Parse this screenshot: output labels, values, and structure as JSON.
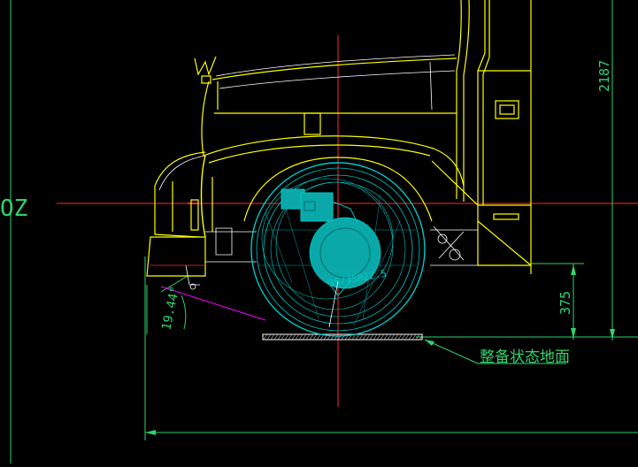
{
  "drawing": {
    "dimension_height": "2187",
    "dimension_ground_clearance": "375",
    "angle_label": "19.44°",
    "partial_dimension_text": "OZ",
    "tire_spec": "35/45R22.5",
    "ground_annotation": "整备状态地面"
  },
  "colors": {
    "background": "#000000",
    "body_lines": "#ffff00",
    "white_lines": "#ffffff",
    "wheel": "#00c8c8",
    "wheel_fill": "#0aa8a8",
    "dimension": "#2fd46b",
    "center_lines": "#ff2a2a",
    "magenta_line": "#ff00ff"
  }
}
